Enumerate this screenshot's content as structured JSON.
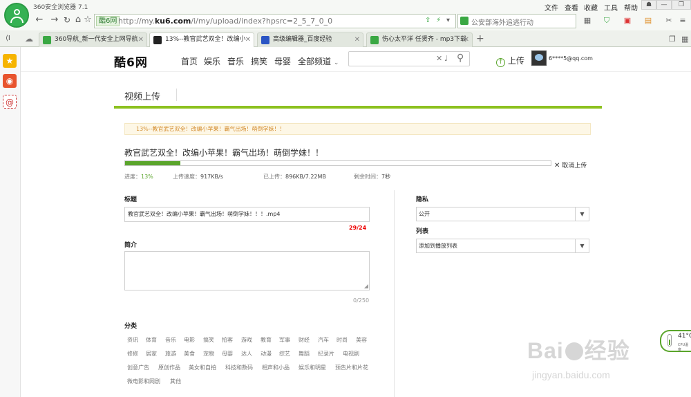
{
  "browser": {
    "app_title": "360安全浏览器 7.1",
    "menus": [
      "文件",
      "查看",
      "收藏",
      "工具",
      "帮助"
    ],
    "address": {
      "site_badge": "酷6网",
      "url_prefix": "http://my.",
      "url_domain": "ku6.com",
      "url_path": "/i/my/upload/index?hpsrc=2_5_7_0_0"
    },
    "search_text": "公安部海外追逃行动",
    "tabs": [
      {
        "label": "360导航_新一代安全上网导航",
        "color": "#3aa843"
      },
      {
        "label": "13%--教官武艺双全！改编小",
        "color": "#222222"
      },
      {
        "label": "高级编辑器_百度经验",
        "color": "#2b55c4"
      },
      {
        "label": "伤心太平洋 任贤齐 - mp3下载",
        "color": "#3aa843"
      }
    ]
  },
  "site": {
    "logo": "酷6网",
    "nav": [
      "首页",
      "娱乐",
      "音乐",
      "搞笑",
      "母婴",
      "全部频道"
    ],
    "upload": "上传",
    "user": "6****5@qq.com"
  },
  "page": {
    "title": "视频上传",
    "notice": "13%--教官武艺双全！改编小苹果！霸气出场！萌倒学妹！！",
    "video_name": "教官武艺双全！改编小苹果！霸气出场！萌倒学妹！！",
    "progress_percent": 13,
    "cancel": "取消上传",
    "stats": {
      "progress_label": "进度：",
      "progress_value": "13%",
      "speed_label": "上传速度：",
      "speed_value": "917KB/s",
      "uploaded_label": "已上传：",
      "uploaded_value": "896KB/7.22MB",
      "remaining_label": "剩余时间：",
      "remaining_value": "7秒"
    },
    "form": {
      "title_label": "标题",
      "title_value": "教官武艺双全！改编小苹果！霸气出场！萌倒学妹！！！.mp4",
      "title_count": "29/24",
      "desc_label": "简介",
      "desc_count": "0/250",
      "privacy_label": "隐私",
      "privacy_value": "公开",
      "list_label": "列表",
      "list_value": "添加到播放列表",
      "category_label": "分类",
      "categories": [
        [
          "资讯",
          "体育",
          "音乐",
          "电影",
          "搞笑",
          "拍客",
          "游戏",
          "教育",
          "军事",
          "财经",
          "汽车",
          "时尚",
          "美容"
        ],
        [
          "修修",
          "居家",
          "旅游",
          "美食",
          "宠物",
          "母婴",
          "达人",
          "动漫",
          "综艺",
          "舞蹈",
          "纪录片",
          "电视剧"
        ],
        [
          "创意广告",
          "原创作品",
          "美女和自拍",
          "科技和数码",
          "相声和小品",
          "娱乐和明星",
          "预告片和片花"
        ],
        [
          "微电影和网剧",
          "其他"
        ]
      ]
    }
  },
  "overlay": {
    "temp": "41°C",
    "temp_sub": "CPU温度",
    "watermark": "Bai",
    "watermark_tail": "经验",
    "watermark_url": "jingyan.baidu.com"
  }
}
